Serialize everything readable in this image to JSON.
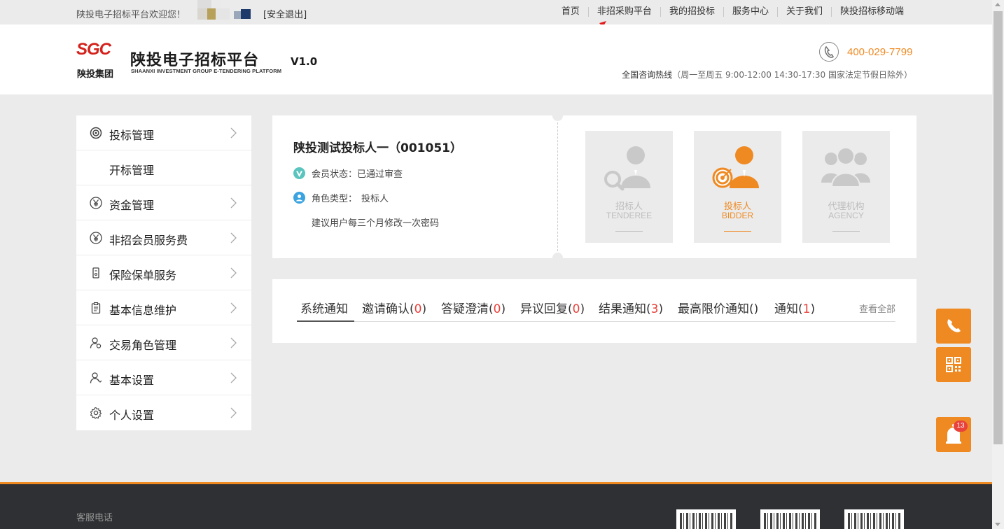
{
  "topbar": {
    "welcome": "陕投电子招标平台欢迎您！",
    "logout": "[安全退出]",
    "nav": [
      "首页",
      "非招采购平台",
      "我的招投标",
      "服务中心",
      "关于我们",
      "陕投招标移动端"
    ]
  },
  "header": {
    "logo_mark": "SGC",
    "logo_group": "陕投集团",
    "title": "陕投电子招标平台",
    "version": "V1.0",
    "subtitle": "SHAANXI INVESTMENT GROUP E-TENDERING PLATFORM",
    "hotline_number": "400-029-7799",
    "hotline_label": "全国咨询热线",
    "hotline_hours": "（周一至周五 9:00-12:00 14:30-17:30 国家法定节假日除外）"
  },
  "sidebar": {
    "items": [
      {
        "label": "投标管理",
        "icon": "target-icon",
        "has_chevron": true
      },
      {
        "label": "开标管理",
        "icon": "",
        "has_chevron": false
      },
      {
        "label": "资金管理",
        "icon": "yuan-icon",
        "has_chevron": true
      },
      {
        "label": "非招会员服务费",
        "icon": "yuan-icon",
        "has_chevron": true
      },
      {
        "label": "保险保单服务",
        "icon": "insurance-icon",
        "has_chevron": true
      },
      {
        "label": "基本信息维护",
        "icon": "clipboard-icon",
        "has_chevron": true
      },
      {
        "label": "交易角色管理",
        "icon": "user-role-icon",
        "has_chevron": true
      },
      {
        "label": "基本设置",
        "icon": "user-settings-icon",
        "has_chevron": true
      },
      {
        "label": "个人设置",
        "icon": "gear-icon",
        "has_chevron": true
      }
    ]
  },
  "profile": {
    "name": "陕投测试投标人一（001051）",
    "status_label": "会员状态：",
    "status_value": "已通过审查",
    "role_label": "角色类型：",
    "role_value": "投标人",
    "tip": "建议用户每三个月修改一次密码"
  },
  "roles": [
    {
      "cn": "招标人",
      "en": "TENDEREE",
      "active": false
    },
    {
      "cn": "投标人",
      "en": "BIDDER",
      "active": true
    },
    {
      "cn": "代理机构",
      "en": "AGENCY",
      "active": false
    }
  ],
  "notices": {
    "tabs": [
      {
        "label": "系统通知",
        "count": null
      },
      {
        "label": "邀请确认",
        "count": "0"
      },
      {
        "label": "答疑澄清",
        "count": "0"
      },
      {
        "label": "异议回复",
        "count": "0"
      },
      {
        "label": "结果通知",
        "count": "3"
      },
      {
        "label": "最高限价通知",
        "count": ""
      },
      {
        "label": "通知",
        "count": "1"
      }
    ],
    "view_all": "查看全部"
  },
  "float": {
    "notification_count": "13"
  },
  "footer": {
    "label": "客服电话"
  },
  "colors": {
    "accent": "#ef8a23",
    "alert": "#e8423b",
    "brand_red": "#d4221c"
  }
}
